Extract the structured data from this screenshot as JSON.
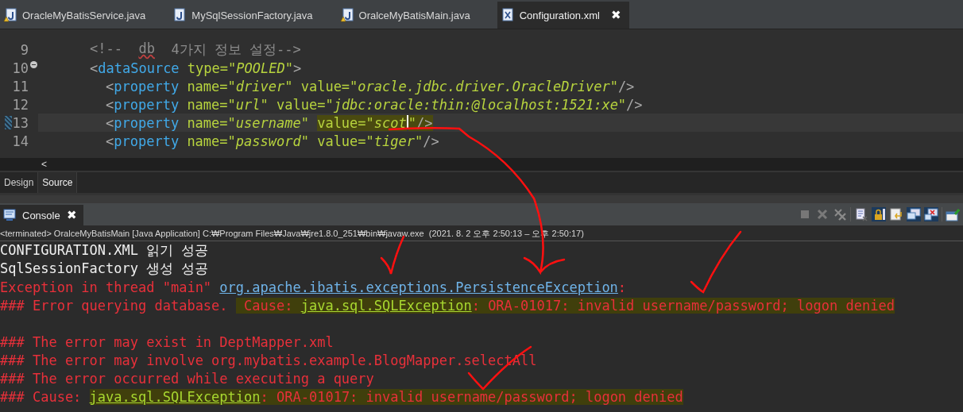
{
  "editor_tabs": [
    {
      "label": "OracleMyBatisService.java",
      "kind": "java-warning",
      "selected": false
    },
    {
      "label": "MySqlSessionFactory.java",
      "kind": "java",
      "selected": false
    },
    {
      "label": "OralceMyBatisMain.java",
      "kind": "java-warning",
      "selected": false
    },
    {
      "label": "Configuration.xml",
      "kind": "xml",
      "selected": true,
      "close": "✖"
    }
  ],
  "editor": {
    "lines": [
      {
        "number": "9",
        "current": false,
        "fold_marker": false,
        "segments": [
          {
            "kind": "comment",
            "text": "<!--  "
          },
          {
            "kind": "comment-spell",
            "text": "db"
          },
          {
            "kind": "comment",
            "text": "  4가지 정보 설정-->"
          }
        ]
      },
      {
        "number": "10",
        "current": false,
        "fold_marker": true,
        "segments": [
          {
            "kind": "punct",
            "text": "<"
          },
          {
            "kind": "tag",
            "text": "dataSource"
          },
          {
            "kind": "attr",
            "text": " type="
          },
          {
            "kind": "value",
            "text": "\"POOLED\""
          },
          {
            "kind": "punct",
            "text": ">"
          }
        ],
        "children": [
          {
            "number": "11",
            "current": false,
            "fold_marker": false,
            "segments": [
              {
                "kind": "punct",
                "text": "<"
              },
              {
                "kind": "tag",
                "text": "property"
              },
              {
                "kind": "attr",
                "text": " name="
              },
              {
                "kind": "value",
                "text": "\"driver\""
              },
              {
                "kind": "attr",
                "text": " value="
              },
              {
                "kind": "value",
                "text": "\"oracle.jdbc.driver.OracleDriver\""
              },
              {
                "kind": "punct",
                "text": "/>"
              }
            ]
          },
          {
            "number": "12",
            "current": false,
            "fold_marker": false,
            "segments": [
              {
                "kind": "punct",
                "text": "<"
              },
              {
                "kind": "tag",
                "text": "property"
              },
              {
                "kind": "attr",
                "text": " name="
              },
              {
                "kind": "value",
                "text": "\"url\""
              },
              {
                "kind": "attr",
                "text": " value="
              },
              {
                "kind": "value",
                "text": "\"jdbc:oracle:thin:@localhost:1521:xe\""
              },
              {
                "kind": "punct",
                "text": "/>"
              }
            ]
          },
          {
            "number": "13",
            "current": true,
            "fold_marker": false,
            "segments": [
              {
                "kind": "punct",
                "text": "<"
              },
              {
                "kind": "tag",
                "text": "property"
              },
              {
                "kind": "attr",
                "text": " name="
              },
              {
                "kind": "value",
                "text": "\"username\" "
              },
              {
                "kind": "attr",
                "text": "value=",
                "hl": true
              },
              {
                "kind": "value",
                "text": "\"scot",
                "hl": true
              },
              {
                "kind": "value",
                "text": "\"",
                "hl": true
              },
              {
                "kind": "punct",
                "text": "/>",
                "hl": true
              }
            ]
          },
          {
            "number": "14",
            "current": false,
            "fold_marker": false,
            "segments": [
              {
                "kind": "punct",
                "text": "<"
              },
              {
                "kind": "tag",
                "text": "property"
              },
              {
                "kind": "attr",
                "text": " name="
              },
              {
                "kind": "value",
                "text": "\"password\""
              },
              {
                "kind": "attr",
                "text": " value="
              },
              {
                "kind": "value",
                "text": "\"tiger\""
              },
              {
                "kind": "punct",
                "text": "/>"
              }
            ]
          }
        ]
      }
    ],
    "scroll_arrow": "<"
  },
  "mode_tabs": [
    {
      "label": "Design",
      "selected": false
    },
    {
      "label": "Source",
      "selected": true
    }
  ],
  "console": {
    "title": "Console",
    "close": "✖",
    "header": "<terminated> OralceMyBatisMain [Java Application] C:₩Program Files₩Java₩jre1.8.0_251₩bin₩javaw.exe  (2021. 8. 2 오후 2:50:13 – 오후 2:50:17)",
    "lines": [
      {
        "gap_before": false,
        "segments": [
          {
            "kind": "out",
            "text": "CONFIGURATION.XML 읽기 성공"
          }
        ]
      },
      {
        "gap_before": false,
        "segments": [
          {
            "kind": "out",
            "text": "SqlSessionFactory 생성 성공"
          }
        ]
      },
      {
        "gap_before": false,
        "segments": [
          {
            "kind": "err",
            "text": "Exception in thread \"main\" "
          },
          {
            "kind": "link",
            "text": "org.apache.ibatis.exceptions.PersistenceException"
          },
          {
            "kind": "err",
            "text": ":"
          }
        ]
      },
      {
        "gap_before": false,
        "segments": [
          {
            "kind": "err",
            "text": "### Error querying database. "
          },
          {
            "kind": "err",
            "text": " Cause: ",
            "hl": true
          },
          {
            "kind": "exlink",
            "text": "java.sql.SQLException",
            "hl": true
          },
          {
            "kind": "err",
            "text": ": ",
            "hl": true
          },
          {
            "kind": "err",
            "text": "ORA-01017: invalid username/password; logon denied",
            "hl": true
          }
        ]
      },
      {
        "gap_before": true,
        "segments": [
          {
            "kind": "err",
            "text": "### The error may exist in DeptMapper.xml"
          }
        ]
      },
      {
        "gap_before": false,
        "segments": [
          {
            "kind": "err",
            "text": "### The error may involve org.mybatis.example.BlogMapper.selectAll"
          }
        ]
      },
      {
        "gap_before": false,
        "segments": [
          {
            "kind": "err",
            "text": "### The error occurred while executing a query"
          }
        ]
      },
      {
        "gap_before": false,
        "segments": [
          {
            "kind": "err",
            "text": "### Cause: "
          },
          {
            "kind": "exlink",
            "text": "java.sql.SQLException",
            "hl": true
          },
          {
            "kind": "err",
            "text": ": ORA-01017: invalid username/password; logon denied",
            "hl": true
          }
        ]
      }
    ]
  }
}
